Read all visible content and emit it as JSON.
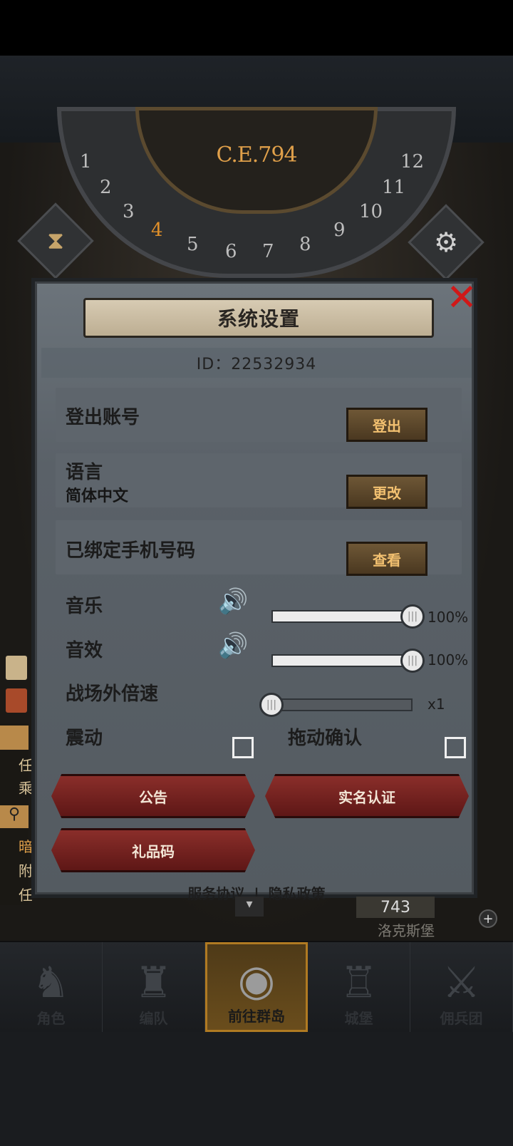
{
  "calendar": {
    "era": "C.E.794",
    "months": [
      "1",
      "2",
      "3",
      "4",
      "5",
      "6",
      "7",
      "8",
      "9",
      "10",
      "11",
      "12"
    ],
    "active_month": "4"
  },
  "dialog": {
    "title": "系统设置",
    "id_text": "ID：22532934",
    "rows": [
      {
        "label": "登出账号",
        "sub": "",
        "button": "登出"
      },
      {
        "label": "语言",
        "sub": "简体中文",
        "button": "更改"
      },
      {
        "label": "已绑定手机号码",
        "sub": "",
        "button": "查看"
      }
    ],
    "music": {
      "label": "音乐",
      "value": "100%",
      "level": 1.0
    },
    "sfx": {
      "label": "音效",
      "value": "100%",
      "level": 1.0
    },
    "speed": {
      "label": "战场外倍速",
      "value": "x1",
      "level": 0.0
    },
    "vibration": {
      "label": "震动",
      "checked": false
    },
    "drag_confirm": {
      "label": "拖动确认",
      "checked": false
    },
    "buttons": {
      "notice": "公告",
      "realname": "实名认证",
      "giftcode": "礼品码"
    },
    "links": {
      "service": "服务协议",
      "separator": "|",
      "privacy": "隐私政策"
    }
  },
  "background": {
    "resource_value": "743",
    "location_name": "洛克斯堡",
    "side_chars": [
      "任",
      "乘",
      "暗",
      "附",
      "任"
    ]
  },
  "nav": [
    {
      "label": "角色",
      "icon": "knight-helmet-icon"
    },
    {
      "label": "编队",
      "icon": "armored-knight-icon"
    },
    {
      "label": "前往群岛",
      "icon": "world-map-icon"
    },
    {
      "label": "城堡",
      "icon": "castle-icon"
    },
    {
      "label": "佣兵团",
      "icon": "mercenary-banner-icon"
    }
  ],
  "colors": {
    "accent_gold": "#e0a04a",
    "close_red": "#d01818",
    "red_button": "#8a2e2a",
    "brown_button": "#6e5736"
  }
}
